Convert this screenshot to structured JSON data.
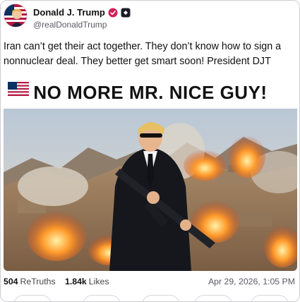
{
  "post": {
    "display_name": "Donald J. Trump",
    "handle": "@realDonaldTrump",
    "text": "Iran can’t get their act together. They don’t know how to sign a nonnuclear deal. They better get smart soon! President DJT",
    "verified_icon": "verified-check-icon",
    "extra_badge_icon": "truth-badge-icon",
    "colors": {
      "verified": "#d21f5c",
      "link_gray": "#5b5b66"
    }
  },
  "media": {
    "headline": "NO MORE MR. NICE GUY!",
    "flag_icon": "us-flag-icon"
  },
  "stats": {
    "retruths_count": "504",
    "retruths_label": "ReTruths",
    "likes_count": "1.84k",
    "likes_label": "Likes",
    "timestamp": "Apr 29, 2026, 1:05 PM"
  }
}
